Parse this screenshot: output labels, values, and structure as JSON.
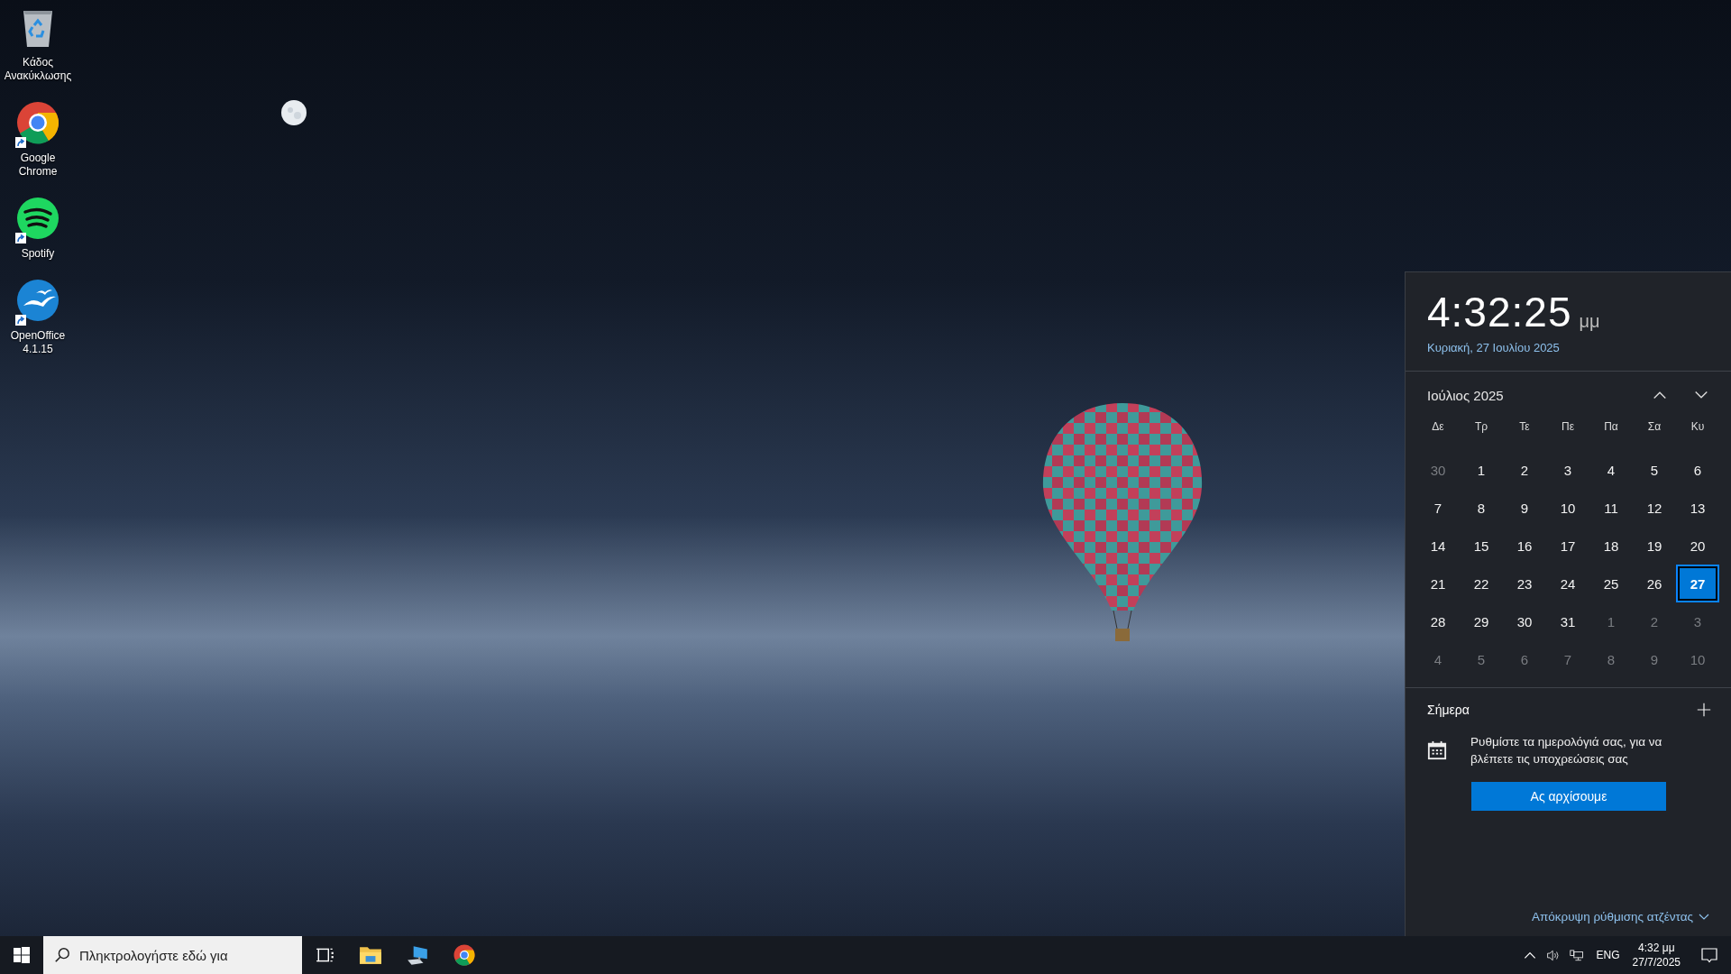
{
  "desktop_icons": [
    {
      "kind": "recycle-bin",
      "label": "Κάδος Ανακύκλωσης",
      "shortcut": false
    },
    {
      "kind": "chrome",
      "label": "Google Chrome",
      "shortcut": true
    },
    {
      "kind": "spotify",
      "label": "Spotify",
      "shortcut": true
    },
    {
      "kind": "openoffice",
      "label": "OpenOffice 4.1.15",
      "shortcut": true
    }
  ],
  "clock": {
    "time": "4:32:25",
    "period": "μμ",
    "date": "Κυριακή, 27 Ιουλίου 2025"
  },
  "calendar": {
    "month": "Ιούλιος 2025",
    "weekdays": [
      "Δε",
      "Τρ",
      "Τε",
      "Πε",
      "Πα",
      "Σα",
      "Κυ"
    ],
    "days": [
      {
        "label": "30",
        "in_month": false,
        "selected": false
      },
      {
        "label": "1",
        "in_month": true,
        "selected": false
      },
      {
        "label": "2",
        "in_month": true,
        "selected": false
      },
      {
        "label": "3",
        "in_month": true,
        "selected": false
      },
      {
        "label": "4",
        "in_month": true,
        "selected": false
      },
      {
        "label": "5",
        "in_month": true,
        "selected": false
      },
      {
        "label": "6",
        "in_month": true,
        "selected": false
      },
      {
        "label": "7",
        "in_month": true,
        "selected": false
      },
      {
        "label": "8",
        "in_month": true,
        "selected": false
      },
      {
        "label": "9",
        "in_month": true,
        "selected": false
      },
      {
        "label": "10",
        "in_month": true,
        "selected": false
      },
      {
        "label": "11",
        "in_month": true,
        "selected": false
      },
      {
        "label": "12",
        "in_month": true,
        "selected": false
      },
      {
        "label": "13",
        "in_month": true,
        "selected": false
      },
      {
        "label": "14",
        "in_month": true,
        "selected": false
      },
      {
        "label": "15",
        "in_month": true,
        "selected": false
      },
      {
        "label": "16",
        "in_month": true,
        "selected": false
      },
      {
        "label": "17",
        "in_month": true,
        "selected": false
      },
      {
        "label": "18",
        "in_month": true,
        "selected": false
      },
      {
        "label": "19",
        "in_month": true,
        "selected": false
      },
      {
        "label": "20",
        "in_month": true,
        "selected": false
      },
      {
        "label": "21",
        "in_month": true,
        "selected": false
      },
      {
        "label": "22",
        "in_month": true,
        "selected": false
      },
      {
        "label": "23",
        "in_month": true,
        "selected": false
      },
      {
        "label": "24",
        "in_month": true,
        "selected": false
      },
      {
        "label": "25",
        "in_month": true,
        "selected": false
      },
      {
        "label": "26",
        "in_month": true,
        "selected": false
      },
      {
        "label": "27",
        "in_month": true,
        "selected": true
      },
      {
        "label": "28",
        "in_month": true,
        "selected": false
      },
      {
        "label": "29",
        "in_month": true,
        "selected": false
      },
      {
        "label": "30",
        "in_month": true,
        "selected": false
      },
      {
        "label": "31",
        "in_month": true,
        "selected": false
      },
      {
        "label": "1",
        "in_month": false,
        "selected": false
      },
      {
        "label": "2",
        "in_month": false,
        "selected": false
      },
      {
        "label": "3",
        "in_month": false,
        "selected": false
      },
      {
        "label": "4",
        "in_month": false,
        "selected": false
      },
      {
        "label": "5",
        "in_month": false,
        "selected": false
      },
      {
        "label": "6",
        "in_month": false,
        "selected": false
      },
      {
        "label": "7",
        "in_month": false,
        "selected": false
      },
      {
        "label": "8",
        "in_month": false,
        "selected": false
      },
      {
        "label": "9",
        "in_month": false,
        "selected": false
      },
      {
        "label": "10",
        "in_month": false,
        "selected": false
      }
    ]
  },
  "agenda": {
    "title": "Σήμερα",
    "message": "Ρυθμίστε τα ημερολόγιά σας, για να βλέπετε τις υποχρεώσεις σας",
    "button": "Ας αρχίσουμε",
    "hide_link": "Απόκρυψη ρύθμισης ατζέντας"
  },
  "taskbar": {
    "search": {
      "placeholder": "Πληκτρολογήστε εδώ για"
    },
    "apps": [
      {
        "kind": "task-view"
      },
      {
        "kind": "explorer"
      },
      {
        "kind": "network-pc"
      },
      {
        "kind": "chrome"
      }
    ],
    "tray": {
      "language": "ENG",
      "time": "4:32 μμ",
      "date": "27/7/2025"
    }
  }
}
